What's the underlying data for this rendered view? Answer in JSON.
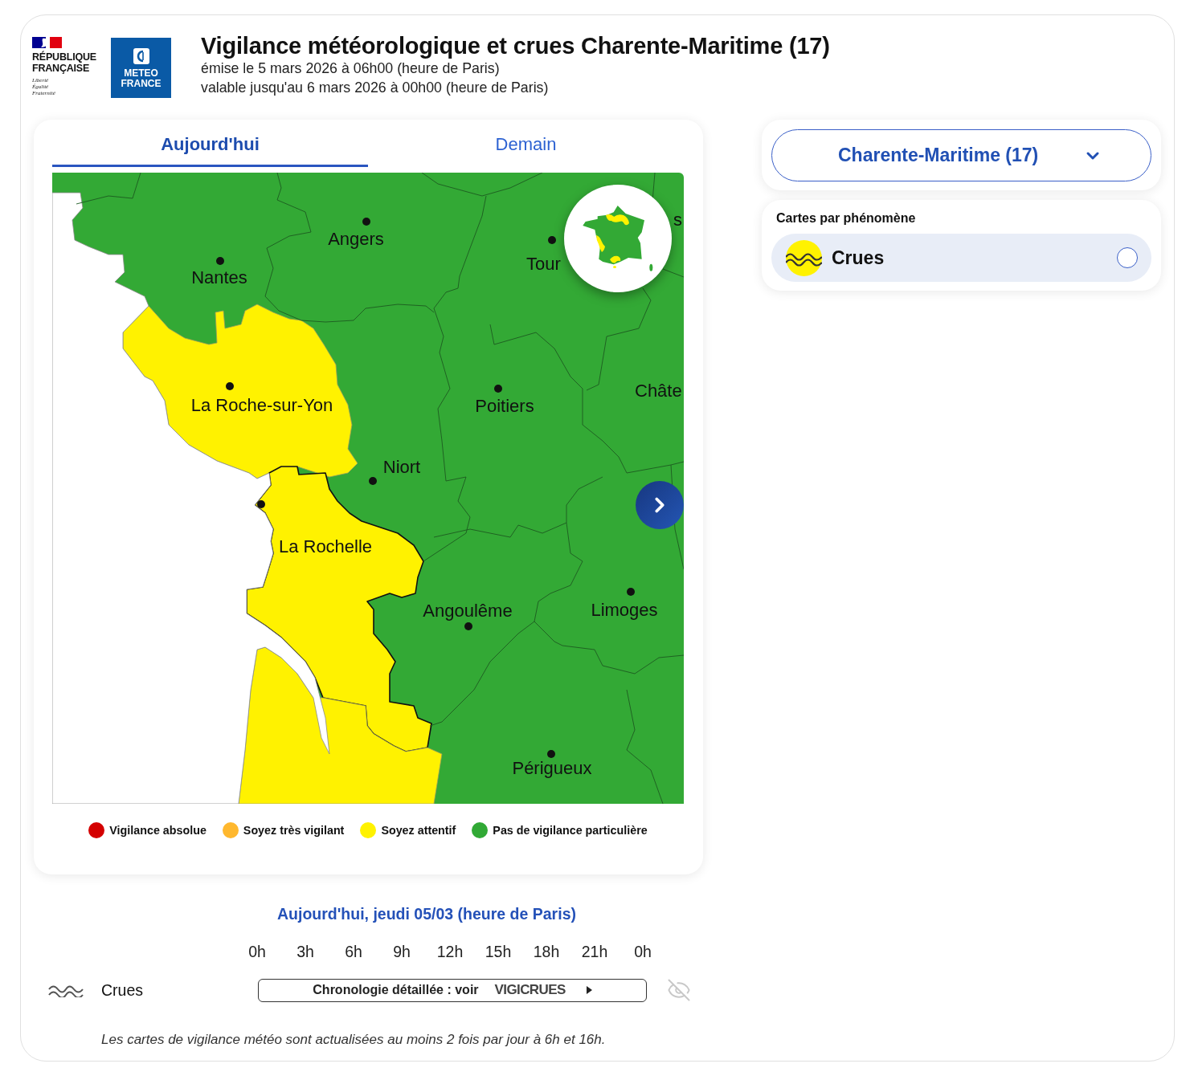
{
  "header": {
    "republic_logo": {
      "name": "RÉPUBLIQUE FRANÇAISE",
      "motto": "Liberté Égalité Fraternité"
    },
    "agency_logo": {
      "name": "METEO FRANCE"
    },
    "title": "Vigilance météorologique et crues Charente-Maritime (17)",
    "issued": "émise le 5 mars 2026 à 06h00 (heure de Paris)",
    "valid_until": "valable jusqu'au 6 mars 2026 à 00h00 (heure de Paris)"
  },
  "tabs": [
    {
      "label": "Aujourd'hui",
      "selected": true
    },
    {
      "label": "Demain",
      "selected": false
    }
  ],
  "map": {
    "zones": [
      {
        "color": "#33a935",
        "selected": false
      },
      {
        "color": "#fff200",
        "selected": false
      },
      {
        "color": "#fff200",
        "selected": true
      },
      {
        "color": "#fff200",
        "selected": false
      }
    ],
    "cities": [
      {
        "name": "Angers"
      },
      {
        "name": "Nantes"
      },
      {
        "name": "Tour"
      },
      {
        "name": "s"
      },
      {
        "name": "La Roche-sur-Yon"
      },
      {
        "name": "Poitiers"
      },
      {
        "name": "Châte"
      },
      {
        "name": "Niort"
      },
      {
        "name": "La Rochelle"
      },
      {
        "name": "Angoulême"
      },
      {
        "name": "Limoges"
      },
      {
        "name": "Périgueux"
      }
    ]
  },
  "legend": [
    {
      "label": "Vigilance absolue",
      "color": "#d40000"
    },
    {
      "label": "Soyez très vigilant",
      "color": "#ffb82e"
    },
    {
      "label": "Soyez attentif",
      "color": "#fff200"
    },
    {
      "label": "Pas de vigilance particulière",
      "color": "#31a935"
    }
  ],
  "timeline": {
    "date": "Aujourd'hui, jeudi 05/03 (heure de Paris)",
    "hours": [
      "0h",
      "3h",
      "6h",
      "9h",
      "12h",
      "15h",
      "18h",
      "21h",
      "0h"
    ],
    "rows": [
      {
        "label": "Crues",
        "link": "Chronologie détaillée : voir",
        "brand": "VIGICRUES",
        "visible": false
      }
    ]
  },
  "note": "Les cartes de vigilance météo sont actualisées au moins 2 fois par jour à 6h et 16h.",
  "department_select": {
    "value": "Charente-Maritime (17)"
  },
  "phenomena": {
    "title": "Cartes par phénomène",
    "items": [
      {
        "label": "Crues",
        "color": "#fff200",
        "selected": false
      }
    ]
  }
}
